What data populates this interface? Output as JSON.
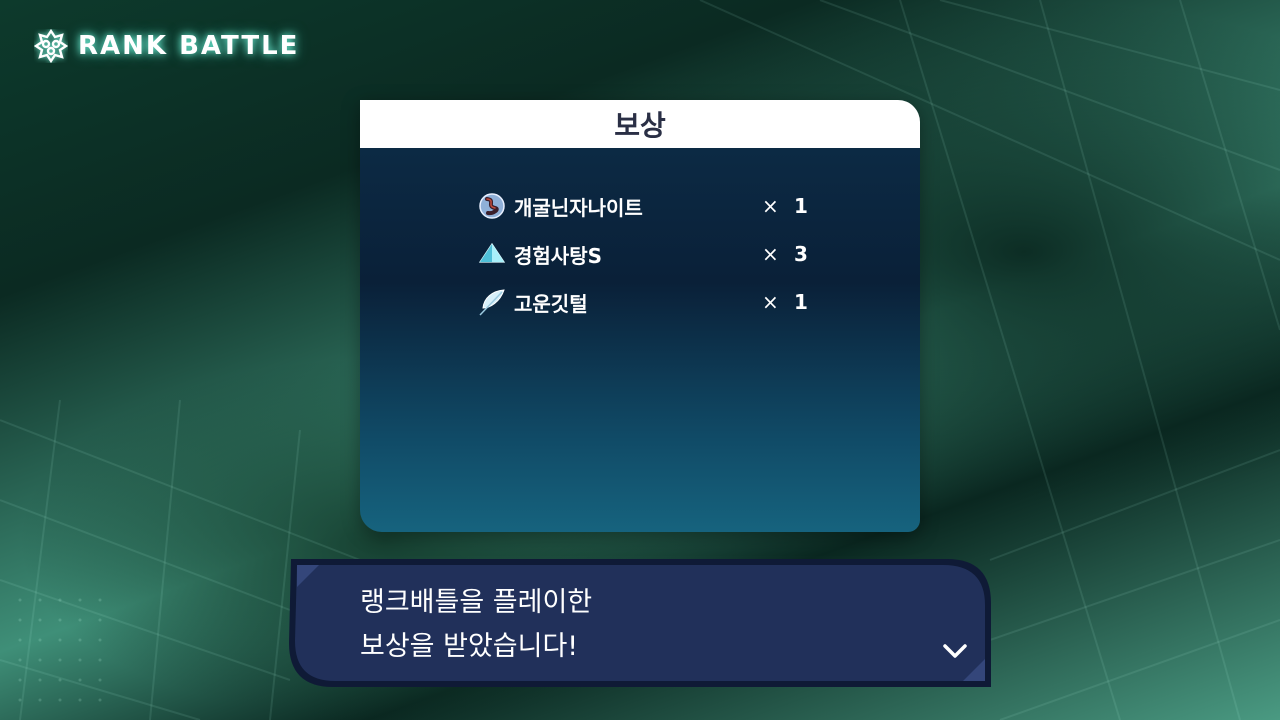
{
  "header": {
    "title": "RANK BATTLE",
    "icon": "gear-badge-icon",
    "glow_color": "#7fffe6"
  },
  "reward_panel": {
    "title": "보상",
    "items": [
      {
        "icon": "dusk-stone-icon",
        "name": "개굴닌자나이트",
        "times": "×",
        "quantity": "1"
      },
      {
        "icon": "exp-candy-icon",
        "name": "경험사탕S",
        "times": "×",
        "quantity": "3"
      },
      {
        "icon": "feather-icon",
        "name": "고운깃털",
        "times": "×",
        "quantity": "1"
      }
    ]
  },
  "dialog": {
    "lines": [
      "랭크배틀을 플레이한",
      "보상을 받았습니다!"
    ],
    "advance_icon": "chevron-down-icon"
  },
  "colors": {
    "panel_header_bg": "#ffffff",
    "panel_body_top": "#0c2a44",
    "panel_body_bottom": "#16637e",
    "dialog_bg": "#20305a",
    "dialog_border": "#0f1a36"
  }
}
